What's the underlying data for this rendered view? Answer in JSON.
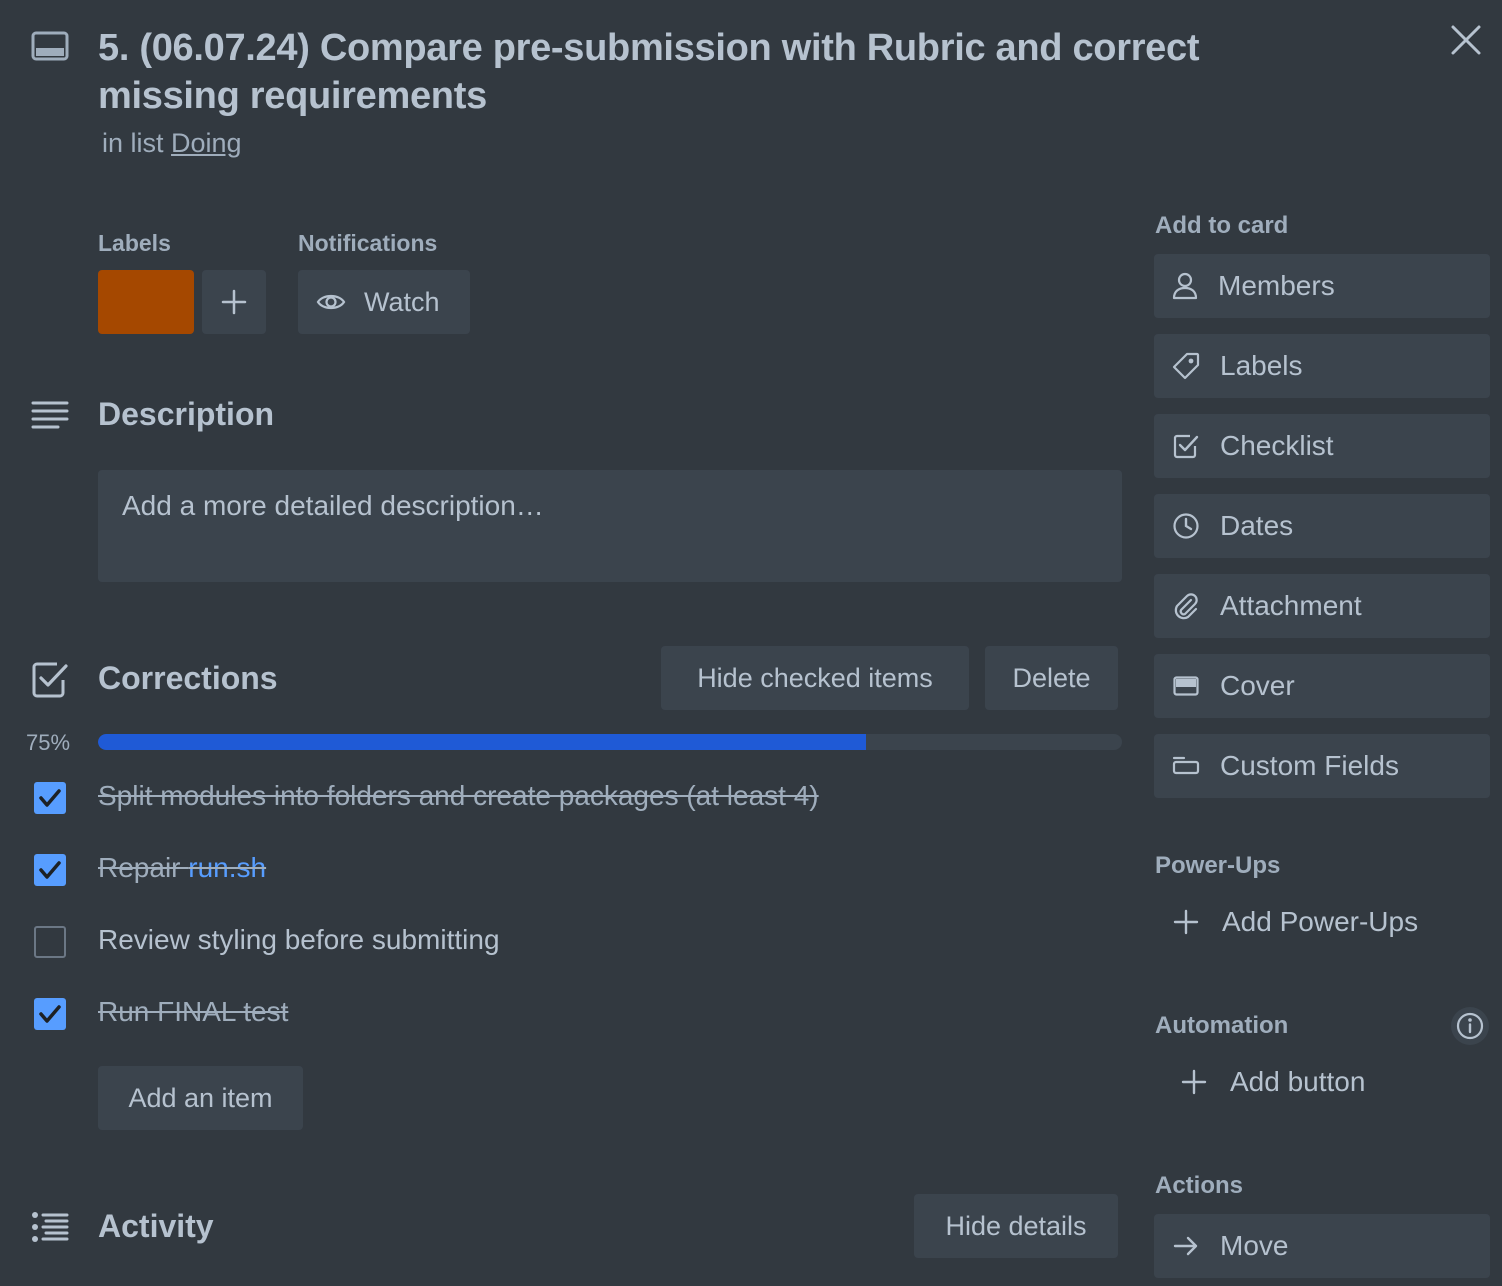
{
  "card": {
    "title": "5. (06.07.24) Compare pre-submission with Rubric and correct missing requirements",
    "in_list_prefix": "in list",
    "list_name": "Doing"
  },
  "labels_section": {
    "heading": "Labels",
    "label_color": "#a54800"
  },
  "notifications_section": {
    "heading": "Notifications",
    "watch_label": "Watch"
  },
  "description": {
    "title": "Description",
    "placeholder": "Add a more detailed description…"
  },
  "checklist": {
    "title": "Corrections",
    "hide_checked_label": "Hide checked items",
    "delete_label": "Delete",
    "progress_text": "75%",
    "progress": 0.75,
    "items": [
      {
        "text": "Split modules into folders and create packages (at least 4)",
        "checked": true
      },
      {
        "text_prefix": "Repair ",
        "link_text": "run.sh",
        "checked": true
      },
      {
        "text": "Review styling before submitting",
        "checked": false
      },
      {
        "text": "Run FINAL test",
        "checked": true
      }
    ],
    "add_item_label": "Add an item"
  },
  "activity": {
    "title": "Activity",
    "hide_details_label": "Hide details"
  },
  "sidebar": {
    "add_to_card_heading": "Add to card",
    "add_to_card": [
      {
        "label": "Members",
        "icon": "person-icon"
      },
      {
        "label": "Labels",
        "icon": "tag-icon"
      },
      {
        "label": "Checklist",
        "icon": "checklist-icon"
      },
      {
        "label": "Dates",
        "icon": "clock-icon"
      },
      {
        "label": "Attachment",
        "icon": "paperclip-icon"
      },
      {
        "label": "Cover",
        "icon": "cover-icon"
      },
      {
        "label": "Custom Fields",
        "icon": "custom-fields-icon"
      }
    ],
    "powerups_heading": "Power-Ups",
    "add_powerups_label": "Add Power-Ups",
    "automation_heading": "Automation",
    "add_button_label": "Add button",
    "actions_heading": "Actions",
    "move_label": "Move"
  },
  "colors": {
    "background": "#323940",
    "button_bg": "#3b444d",
    "progress_fill": "#1f5ad6",
    "checkbox_checked": "#579dff",
    "link": "#579dff"
  }
}
